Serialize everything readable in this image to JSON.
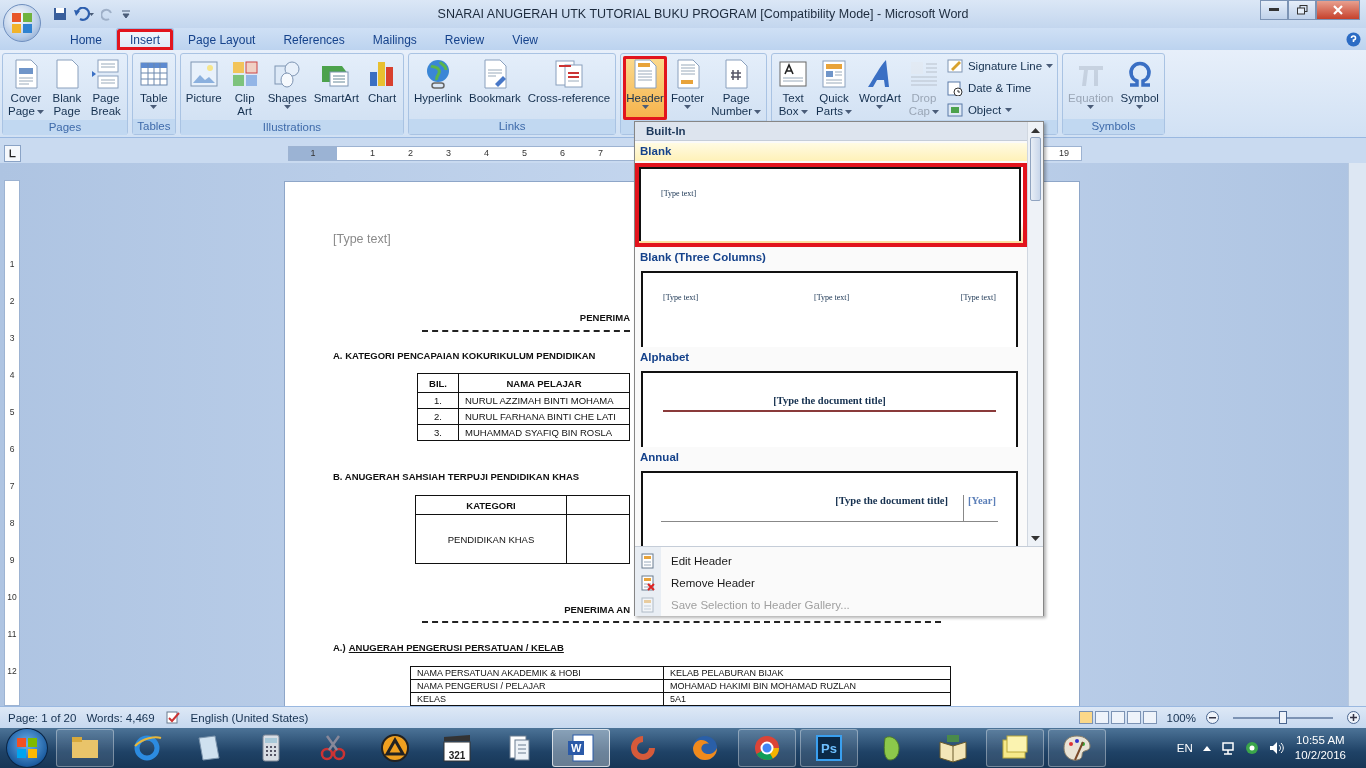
{
  "window": {
    "title": "SNARAI ANUGERAH UTK TUTORIAL BUKU PROGRAM [Compatibility Mode] - Microsoft Word"
  },
  "tabs": [
    {
      "label": "Home",
      "selected": false,
      "highlighted": false
    },
    {
      "label": "Insert",
      "selected": true,
      "highlighted": true
    },
    {
      "label": "Page Layout",
      "selected": false,
      "highlighted": false
    },
    {
      "label": "References",
      "selected": false,
      "highlighted": false
    },
    {
      "label": "Mailings",
      "selected": false,
      "highlighted": false
    },
    {
      "label": "Review",
      "selected": false,
      "highlighted": false
    },
    {
      "label": "View",
      "selected": false,
      "highlighted": false
    }
  ],
  "ribbon": {
    "groups": [
      {
        "label": "Pages",
        "buttons": [
          {
            "kind": "large",
            "lines": [
              "Cover",
              "Page"
            ],
            "dropdown": true,
            "pressed": false,
            "disabled": false,
            "highlighted": false
          },
          {
            "kind": "large",
            "lines": [
              "Blank",
              "Page"
            ],
            "dropdown": false,
            "pressed": false,
            "disabled": false,
            "highlighted": false
          },
          {
            "kind": "large",
            "lines": [
              "Page",
              "Break"
            ],
            "dropdown": false,
            "pressed": false,
            "disabled": false,
            "highlighted": false
          }
        ]
      },
      {
        "label": "Tables",
        "buttons": [
          {
            "kind": "large",
            "lines": [
              "Table"
            ],
            "dropdown": true,
            "pressed": false,
            "disabled": false,
            "highlighted": false
          }
        ]
      },
      {
        "label": "Illustrations",
        "buttons": [
          {
            "kind": "large",
            "lines": [
              "Picture"
            ],
            "dropdown": false,
            "pressed": false,
            "disabled": false,
            "highlighted": false
          },
          {
            "kind": "large",
            "lines": [
              "Clip",
              "Art"
            ],
            "dropdown": false,
            "pressed": false,
            "disabled": false,
            "highlighted": false
          },
          {
            "kind": "large",
            "lines": [
              "Shapes"
            ],
            "dropdown": true,
            "pressed": false,
            "disabled": false,
            "highlighted": false
          },
          {
            "kind": "large",
            "lines": [
              "SmartArt"
            ],
            "dropdown": false,
            "pressed": false,
            "disabled": false,
            "highlighted": false
          },
          {
            "kind": "large",
            "lines": [
              "Chart"
            ],
            "dropdown": false,
            "pressed": false,
            "disabled": false,
            "highlighted": false
          }
        ]
      },
      {
        "label": "Links",
        "buttons": [
          {
            "kind": "large",
            "lines": [
              "Hyperlink"
            ],
            "dropdown": false,
            "pressed": false,
            "disabled": false,
            "highlighted": false
          },
          {
            "kind": "large",
            "lines": [
              "Bookmark"
            ],
            "dropdown": false,
            "pressed": false,
            "disabled": false,
            "highlighted": false
          },
          {
            "kind": "large",
            "lines": [
              "Cross-reference"
            ],
            "dropdown": false,
            "pressed": false,
            "disabled": false,
            "highlighted": false
          }
        ]
      },
      {
        "buttons": [
          {
            "kind": "large",
            "lines": [
              "Header"
            ],
            "dropdown": true,
            "pressed": true,
            "disabled": false,
            "highlighted": true
          },
          {
            "kind": "large",
            "lines": [
              "Footer"
            ],
            "dropdown": true,
            "pressed": false,
            "disabled": false,
            "highlighted": false
          },
          {
            "kind": "large",
            "lines": [
              "Page",
              "Number"
            ],
            "dropdown": true,
            "pressed": false,
            "disabled": false,
            "highlighted": false
          }
        ]
      },
      {
        "buttons": [
          {
            "kind": "large",
            "lines": [
              "Text",
              "Box"
            ],
            "dropdown": true,
            "pressed": false,
            "disabled": false,
            "highlighted": false
          },
          {
            "kind": "large",
            "lines": [
              "Quick",
              "Parts"
            ],
            "dropdown": true,
            "pressed": false,
            "disabled": false,
            "highlighted": false
          },
          {
            "kind": "large",
            "lines": [
              "WordArt"
            ],
            "dropdown": true,
            "pressed": false,
            "disabled": false,
            "highlighted": false
          },
          {
            "kind": "large",
            "lines": [
              "Drop",
              "Cap"
            ],
            "dropdown": true,
            "pressed": false,
            "disabled": true,
            "highlighted": false
          },
          {
            "kind": "small",
            "lines": [
              "Signature Line"
            ],
            "dropdown": true,
            "pressed": false,
            "disabled": false,
            "highlighted": false
          },
          {
            "kind": "small",
            "lines": [
              "Date & Time"
            ],
            "dropdown": false,
            "pressed": false,
            "disabled": false,
            "highlighted": false
          },
          {
            "kind": "small",
            "lines": [
              "Object"
            ],
            "dropdown": true,
            "pressed": false,
            "disabled": false,
            "highlighted": false
          }
        ]
      },
      {
        "label": "Symbols",
        "buttons": [
          {
            "kind": "large",
            "lines": [
              "Equation"
            ],
            "dropdown": true,
            "pressed": false,
            "disabled": true,
            "highlighted": false
          },
          {
            "kind": "large",
            "lines": [
              "Symbol"
            ],
            "dropdown": true,
            "pressed": false,
            "disabled": false,
            "highlighted": false
          }
        ]
      }
    ]
  },
  "ruler": {
    "left_numbers": [
      "1",
      "1",
      "2",
      "3",
      "4",
      "5",
      "6",
      "7"
    ],
    "right_numbers": [
      "19"
    ],
    "vertical_numbers": [
      "1",
      "2",
      "3",
      "4",
      "5",
      "6",
      "7",
      "8",
      "9",
      "10",
      "11",
      "12"
    ]
  },
  "document": {
    "header_placeholder": "[Type text]",
    "upper": [
      {
        "kind": "heading",
        "text": "PENERIMA"
      },
      {
        "kind": "rule"
      },
      {
        "kind": "section",
        "text": "A. KATEGORI PENCAPAIAN KOKURIKULUM PENDIDIKAN"
      },
      {
        "kind": "table",
        "columns": [
          "BIL.",
          "NAMA PELAJAR"
        ],
        "rows": [
          [
            "1.",
            "NURUL AZZIMAH BINTI MOHAMA"
          ],
          [
            "2.",
            "NURUL FARHANA BINTI CHE LATI"
          ],
          [
            "3.",
            "MUHAMMAD SYAFIQ BIN ROSLA"
          ]
        ]
      },
      {
        "kind": "section",
        "text": "B. ANUGERAH SAHSIAH TERPUJI PENDIDIKAN KHAS"
      },
      {
        "kind": "table",
        "blank_column": true,
        "columns": [
          "KATEGORI"
        ],
        "rows": [
          [
            "PENDIDIKAN KHAS"
          ]
        ]
      },
      {
        "kind": "heading",
        "text": "PENERIMA AN"
      }
    ],
    "lower": [
      {
        "kind": "rule"
      },
      {
        "kind": "underlined",
        "prefix": "A.)",
        "text": "ANUGERAH PENGERUSI PERSATUAN / KELAB"
      },
      {
        "kind": "table",
        "rows": [
          [
            "NAMA PERSATUAN AKADEMIK & HOBI",
            "KELAB PELABURAN BIJAK"
          ],
          [
            "NAMA PENGERUSI / PELAJAR",
            "MOHAMAD HAKIMI BIN MOHAMAD RUZLAN"
          ],
          [
            "KELAS",
            "5A1"
          ]
        ]
      }
    ]
  },
  "header_menu": {
    "section": "Built-In",
    "gallery": [
      {
        "kind": "blank",
        "label": "Blank",
        "highlighted": true,
        "texts": [
          "[Type text]"
        ]
      },
      {
        "kind": "three",
        "label": "Blank (Three Columns)",
        "highlighted": false,
        "texts": [
          "[Type text]",
          "[Type text]",
          "[Type text]"
        ]
      },
      {
        "kind": "alphabet",
        "label": "Alphabet",
        "highlighted": false,
        "texts": [
          "[Type the document title]"
        ]
      },
      {
        "kind": "annual",
        "label": "Annual",
        "highlighted": false,
        "texts": [
          "[Type the document title]",
          "[Year]"
        ]
      }
    ],
    "commands": [
      {
        "label": "Edit Header",
        "disabled": false
      },
      {
        "label": "Remove Header",
        "disabled": false
      },
      {
        "label": "Save Selection to Header Gallery...",
        "disabled": true
      }
    ]
  },
  "status_bar": {
    "page": "Page: 1 of 20",
    "words": "Words: 4,469",
    "language": "English (United States)",
    "zoom": "100%",
    "zoom_level": {
      "level": 0.5
    }
  },
  "taskbar": {
    "items": [
      {
        "running": true,
        "active": false
      },
      {
        "running": false,
        "active": false
      },
      {
        "running": false,
        "active": false
      },
      {
        "running": false,
        "active": false
      },
      {
        "running": false,
        "active": false
      },
      {
        "running": false,
        "active": false
      },
      {
        "running": false,
        "active": false,
        "label": "321"
      },
      {
        "running": false,
        "active": false
      },
      {
        "running": true,
        "active": true,
        "label": "W"
      },
      {
        "running": false,
        "active": false
      },
      {
        "running": false,
        "active": false
      },
      {
        "running": true,
        "active": false
      },
      {
        "running": true,
        "active": false,
        "label": "Ps"
      },
      {
        "running": false,
        "active": false
      },
      {
        "running": false,
        "active": false
      },
      {
        "running": true,
        "active": false
      },
      {
        "running": true,
        "active": false
      }
    ],
    "language": "EN",
    "time": "10:55 AM",
    "date": "10/2/2016"
  }
}
